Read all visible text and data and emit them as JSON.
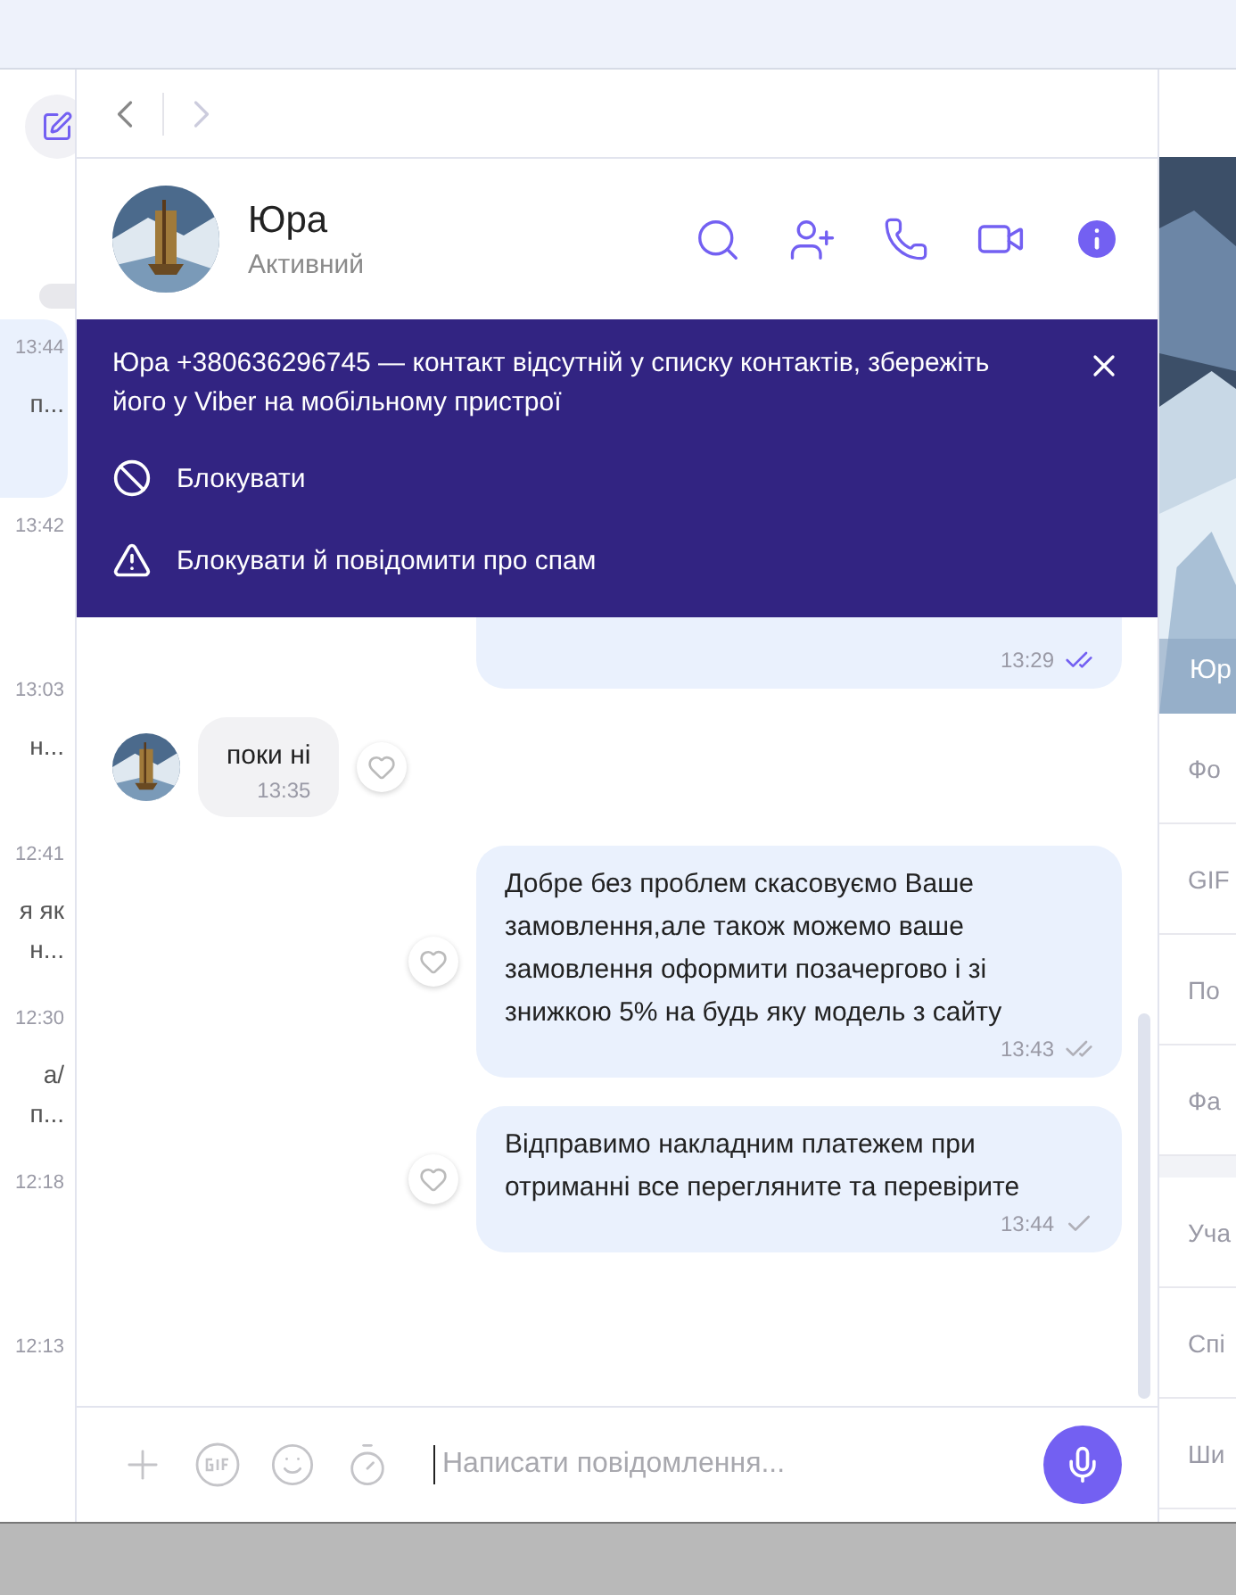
{
  "sidebar": {
    "items": [
      {
        "time": "13:44",
        "preview": "п...",
        "selected": true
      },
      {
        "time": "13:42",
        "selected": false
      },
      {
        "time": "13:03",
        "preview": "н...",
        "selected": false
      },
      {
        "time": "12:41",
        "preview": "я як",
        "preview2": "н...",
        "selected": false
      },
      {
        "time": "12:30",
        "preview": "а/",
        "preview2": "п...",
        "selected": false
      },
      {
        "time": "12:18",
        "selected": false
      },
      {
        "time": "12:13",
        "selected": false
      }
    ]
  },
  "contact": {
    "name": "Юра",
    "status": "Активний"
  },
  "banner": {
    "text": "Юра +380636296745 — контакт відсутній у списку контактів, збережіть його у Viber на мобільному пристрої",
    "actions": [
      {
        "kind": "block",
        "label": "Блокувати"
      },
      {
        "kind": "report",
        "label": "Блокувати й повідомити про спам"
      }
    ]
  },
  "messages": [
    {
      "kind": "outgoing",
      "time": "13:29",
      "delivered": true,
      "read": true
    },
    {
      "kind": "incoming",
      "text": "поки ні",
      "time": "13:35"
    },
    {
      "kind": "outgoing",
      "text": "Добре без проблем скасовуємо Ваше замовлення,але також можемо ваше замовлення оформити позачергово і зі знижкою 5% на будь яку модель з сайту",
      "time": "13:43",
      "delivered": true,
      "read": false
    },
    {
      "kind": "outgoing",
      "text": "Відправимо накладним платежем при отриманні все перегляните та перевірите",
      "time": "13:44",
      "delivered": false,
      "read": false
    }
  ],
  "composer": {
    "placeholder": "Написати повідомлення..."
  },
  "info_panel": {
    "caption": "Юр",
    "items": [
      {
        "label": "Фо"
      },
      {
        "label": "GIF"
      },
      {
        "label": "По"
      },
      {
        "label": "Фа"
      },
      {
        "label": "Уча",
        "group_start": true
      },
      {
        "label": "Спі"
      },
      {
        "label": "Ши"
      }
    ]
  }
}
